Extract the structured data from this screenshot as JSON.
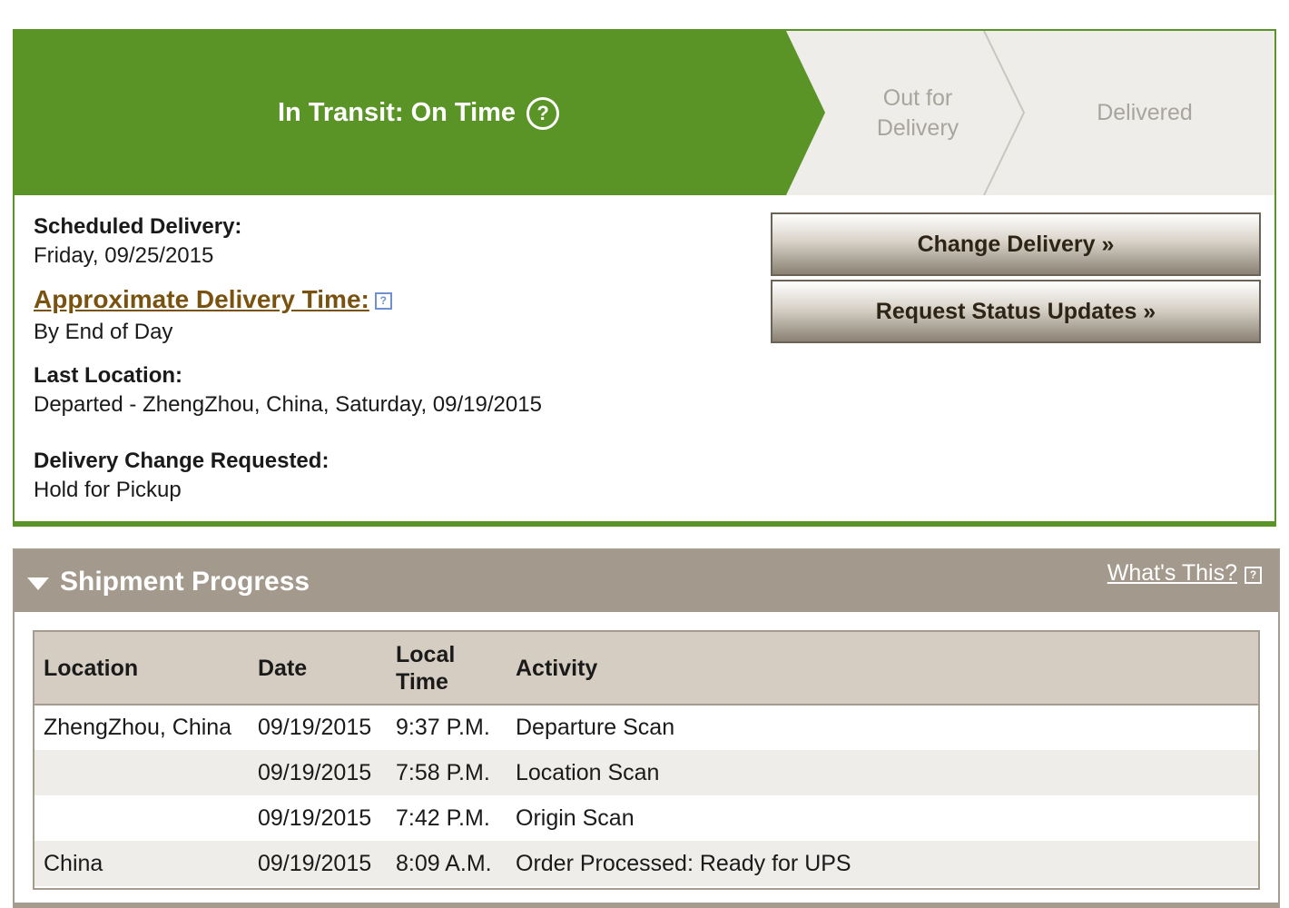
{
  "status": {
    "active_stage": "In Transit: On Time",
    "help_symbol": "?",
    "stages": [
      "Out for\nDelivery",
      "Delivered"
    ],
    "colors": {
      "active": "#5a9427",
      "inactive": "#eeedea",
      "inactive_text": "#a8a59d"
    }
  },
  "details": {
    "scheduled_label": "Scheduled Delivery:",
    "scheduled_value": "Friday, 09/25/2015",
    "approx_label": "Approximate Delivery Time:",
    "approx_value": "By End of Day",
    "last_location_label": "Last Location:",
    "last_location_value": "Departed - ZhengZhou, China, Saturday, 09/19/2015",
    "change_label": "Delivery Change Requested:",
    "change_value": "Hold for Pickup"
  },
  "buttons": {
    "change_delivery": "Change Delivery »",
    "request_updates": "Request Status Updates »"
  },
  "shipment": {
    "title": "Shipment Progress",
    "whats_this": "What's This?",
    "headers": [
      "Location",
      "Date",
      "Local\nTime",
      "Activity"
    ],
    "rows": [
      [
        "ZhengZhou, China",
        "09/19/2015",
        "9:37 P.M.",
        "Departure Scan"
      ],
      [
        "",
        "09/19/2015",
        "7:58 P.M.",
        "Location Scan"
      ],
      [
        "",
        "09/19/2015",
        "7:42 P.M.",
        "Origin Scan"
      ],
      [
        "China",
        "09/19/2015",
        "8:09 A.M.",
        "Order Processed: Ready for UPS"
      ]
    ]
  }
}
